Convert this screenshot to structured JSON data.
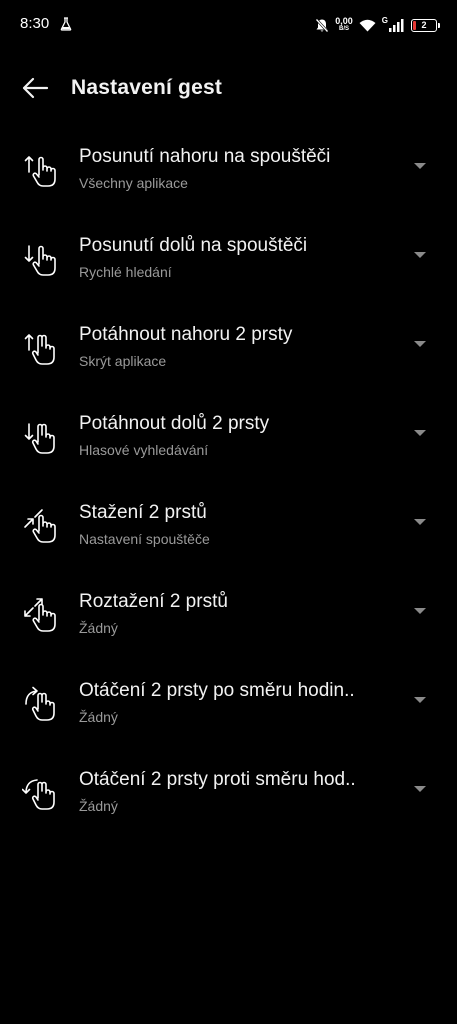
{
  "status_bar": {
    "time": "8:30",
    "net_speed_value": "0,00",
    "net_speed_unit": "B/S",
    "network_type": "G",
    "battery_level": "2",
    "icons": [
      "flask-icon",
      "bell-off-icon",
      "wifi-icon",
      "signal-icon",
      "battery-icon"
    ],
    "battery_color": "#e53935"
  },
  "app_bar": {
    "title": "Nastavení gest",
    "back_icon": "arrow-left-icon"
  },
  "gestures": [
    {
      "title": "Posunutí nahoru na spouštěči",
      "value": "Všechny aplikace",
      "icon": "swipe-up-one-finger-icon"
    },
    {
      "title": "Posunutí dolů na spouštěči",
      "value": "Rychlé hledání",
      "icon": "swipe-down-one-finger-icon"
    },
    {
      "title": "Potáhnout nahoru 2 prsty",
      "value": "Skrýt aplikace",
      "icon": "swipe-up-two-finger-icon"
    },
    {
      "title": "Potáhnout dolů 2 prsty",
      "value": "Hlasové vyhledávání",
      "icon": "swipe-down-two-finger-icon"
    },
    {
      "title": "Stažení 2 prstů",
      "value": "Nastavení spouštěče",
      "icon": "pinch-in-icon"
    },
    {
      "title": "Roztažení 2 prstů",
      "value": "Žádný",
      "icon": "pinch-out-icon"
    },
    {
      "title": "Otáčení 2 prsty po směru hodin..",
      "value": "Žádný",
      "icon": "rotate-clockwise-icon"
    },
    {
      "title": "Otáčení 2 prsty proti směru hod..",
      "value": "Žádný",
      "icon": "rotate-counterclockwise-icon"
    }
  ],
  "colors": {
    "background": "#000000",
    "primary_text": "#f2f2f2",
    "secondary_text": "#9a9a9a",
    "arrow": "#8a8a8a"
  }
}
